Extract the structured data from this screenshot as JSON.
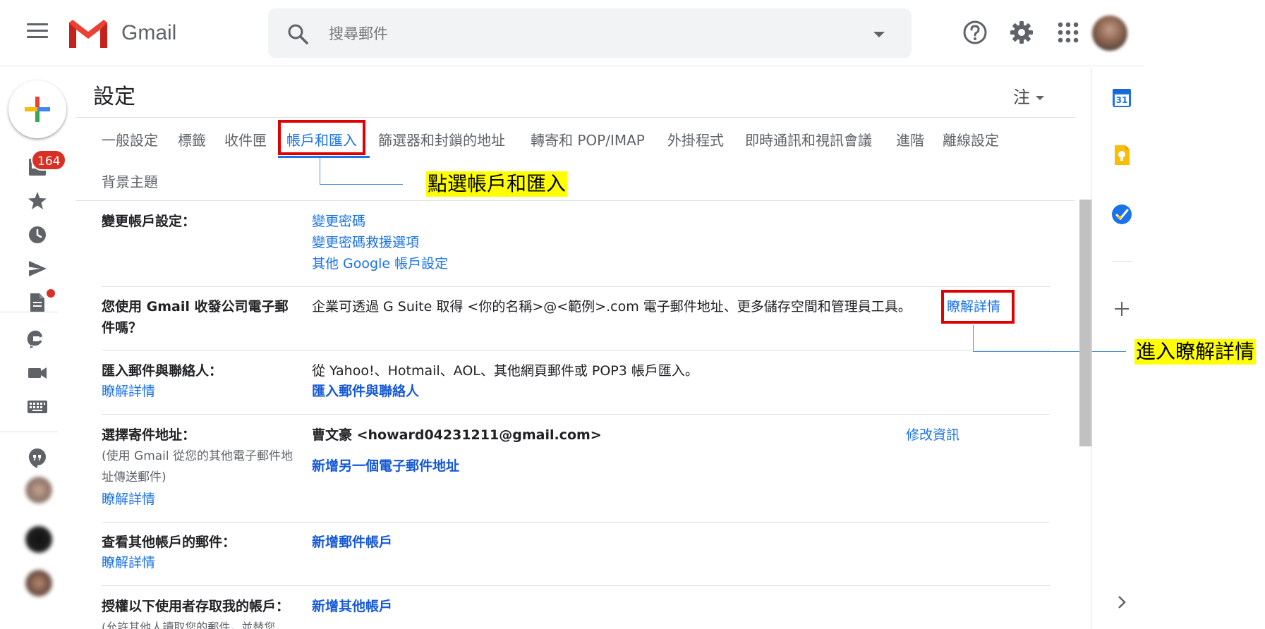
{
  "header": {
    "app_name": "Gmail",
    "search_placeholder": "搜尋郵件",
    "icons": [
      "menu-icon",
      "gmail-logo",
      "search-icon",
      "search-options-caret",
      "help-icon",
      "settings-gear-icon",
      "apps-grid-icon",
      "account-avatar"
    ]
  },
  "left_rail": {
    "unread_badge": "164",
    "icons": [
      "compose-plus-icon",
      "inbox-icon",
      "star-icon",
      "clock-icon",
      "send-icon",
      "draft-icon",
      "meet-icon",
      "video-icon",
      "keyboard-icon",
      "hangouts-icon"
    ]
  },
  "settings": {
    "title": "設定",
    "lang_selector": "注",
    "tabs": [
      "一般設定",
      "標籤",
      "收件匣",
      "帳戶和匯入",
      "篩選器和封鎖的地址",
      "轉寄和 POP/IMAP",
      "外掛程式",
      "即時通訊和視訊會議",
      "進階",
      "離線設定",
      "背景主題"
    ],
    "active_tab": "帳戶和匯入",
    "callout_tab": "點選帳戶和匯入",
    "callout_learn": "進入瞭解詳情",
    "rows": {
      "change_account": {
        "label": "變更帳戶設定：",
        "links": [
          "變更密碼",
          "變更密碼救援選項",
          "其他 Google 帳戶設定"
        ]
      },
      "gsuite": {
        "label_line1": "您使用 Gmail 收發公司電子郵",
        "label_line2": "件嗎？",
        "text": "企業可透過 G Suite 取得 <你的名稱>@<範例>.com 電子郵件地址、更多儲存空間和管理員工具。",
        "link": "瞭解詳情"
      },
      "import": {
        "label": "匯入郵件與聯絡人：",
        "learn_more": "瞭解詳情",
        "text": "從 Yahoo!、Hotmail、AOL、其他網頁郵件或 POP3 帳戶匯入。",
        "action": "匯入郵件與聯絡人"
      },
      "send_as": {
        "label": "選擇寄件地址：",
        "sub_line1": "(使用 Gmail 從您的其他電子郵件地",
        "sub_line2": "址傳送郵件)",
        "learn_more": "瞭解詳情",
        "address": "曹文豪 <howard04231211@gmail.com>",
        "edit": "修改資訊",
        "add": "新增另一個電子郵件地址"
      },
      "check_mail": {
        "label": "查看其他帳戶的郵件：",
        "learn_more": "瞭解詳情",
        "action": "新增郵件帳戶"
      },
      "grant_access": {
        "label": "授權以下使用者存取我的帳戶：",
        "action": "新增其他帳戶",
        "sub_line1": "(允許其他人讀取您的郵件，並替您"
      }
    }
  },
  "side_panel": {
    "calendar_date": "31",
    "icons": [
      "calendar-icon",
      "keep-icon",
      "tasks-icon",
      "add-addon-icon",
      "expand-panel-icon"
    ]
  },
  "colors": {
    "accent": "#1a73e8",
    "highlight": "#ffff00",
    "annotation_red": "#e00000",
    "badge_red": "#d93025"
  }
}
